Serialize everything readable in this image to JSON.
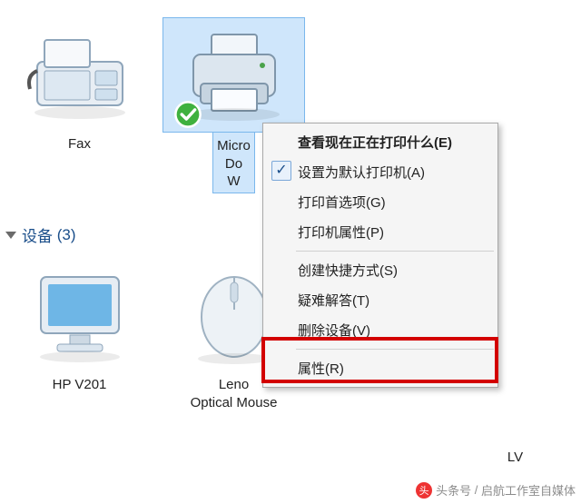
{
  "section": {
    "label": "设备",
    "count": "(3)"
  },
  "devices": {
    "fax": {
      "label": "Fax"
    },
    "xps": {
      "label": "Microsoft XPS Document Writer",
      "label_visible": "Micro\nDo\nW"
    },
    "hp": {
      "label": "HP V201"
    },
    "mouse": {
      "label": "Lenovo Optical Mouse",
      "label_visible_line1": "Leno",
      "label_visible_line2": "Optical Mouse"
    },
    "lv": {
      "label": "LV"
    }
  },
  "context_menu": {
    "items": [
      {
        "id": "see-printing",
        "label": "查看现在正在打印什么(E)"
      },
      {
        "id": "set-default",
        "label": "设置为默认打印机(A)",
        "checked": true
      },
      {
        "id": "printing-prefs",
        "label": "打印首选项(G)"
      },
      {
        "id": "printer-props",
        "label": "打印机属性(P)"
      },
      {
        "sep": true
      },
      {
        "id": "create-shortcut",
        "label": "创建快捷方式(S)"
      },
      {
        "id": "troubleshoot",
        "label": "疑难解答(T)"
      },
      {
        "id": "remove-device",
        "label": "删除设备(V)"
      },
      {
        "sep": true
      },
      {
        "id": "properties",
        "label": "属性(R)"
      }
    ]
  },
  "watermark": {
    "prefix": "头条号",
    "author": "启航工作室自媒体"
  }
}
